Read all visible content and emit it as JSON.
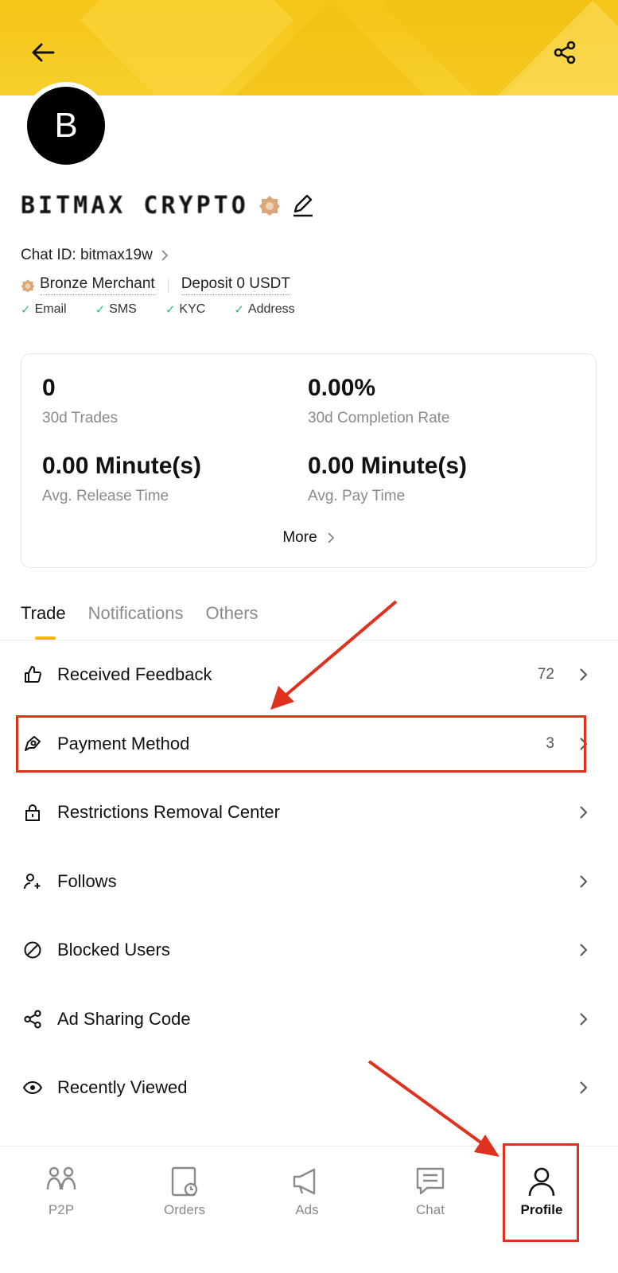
{
  "profile": {
    "avatar_letter": "B",
    "name": "BITMAX CRYPTO",
    "chat_id": "Chat ID: bitmax19w",
    "merchant_level": "Bronze Merchant",
    "deposit": "Deposit 0 USDT",
    "verifications": [
      "Email",
      "SMS",
      "KYC",
      "Address"
    ]
  },
  "stats": {
    "trades_value": "0",
    "trades_label": "30d Trades",
    "completion_value": "0.00%",
    "completion_label": "30d Completion Rate",
    "release_value": "0.00 Minute(s)",
    "release_label": "Avg. Release Time",
    "pay_value": "0.00 Minute(s)",
    "pay_label": "Avg. Pay Time",
    "more_label": "More"
  },
  "tabs": [
    "Trade",
    "Notifications",
    "Others"
  ],
  "active_tab": "Trade",
  "menu": [
    {
      "label": "Received Feedback",
      "count": "72",
      "icon": "thumbs-up-icon"
    },
    {
      "label": "Payment Method",
      "count": "3",
      "icon": "payment-method-icon"
    },
    {
      "label": "Restrictions Removal Center",
      "count": "",
      "icon": "lock-icon"
    },
    {
      "label": "Follows",
      "count": "",
      "icon": "user-plus-icon"
    },
    {
      "label": "Blocked Users",
      "count": "",
      "icon": "blocked-icon"
    },
    {
      "label": "Ad Sharing Code",
      "count": "",
      "icon": "share-icon"
    },
    {
      "label": "Recently Viewed",
      "count": "",
      "icon": "eye-icon"
    }
  ],
  "bottom_nav": [
    {
      "label": "P2P",
      "icon": "p2p-icon"
    },
    {
      "label": "Orders",
      "icon": "orders-icon"
    },
    {
      "label": "Ads",
      "icon": "megaphone-icon"
    },
    {
      "label": "Chat",
      "icon": "chat-icon"
    },
    {
      "label": "Profile",
      "icon": "profile-icon"
    }
  ],
  "active_nav": "Profile",
  "colors": {
    "header_yellow": "#f5c518",
    "accent": "#f0b90b",
    "verify_green": "#2ebd85",
    "annotation_red": "#e0311f"
  }
}
